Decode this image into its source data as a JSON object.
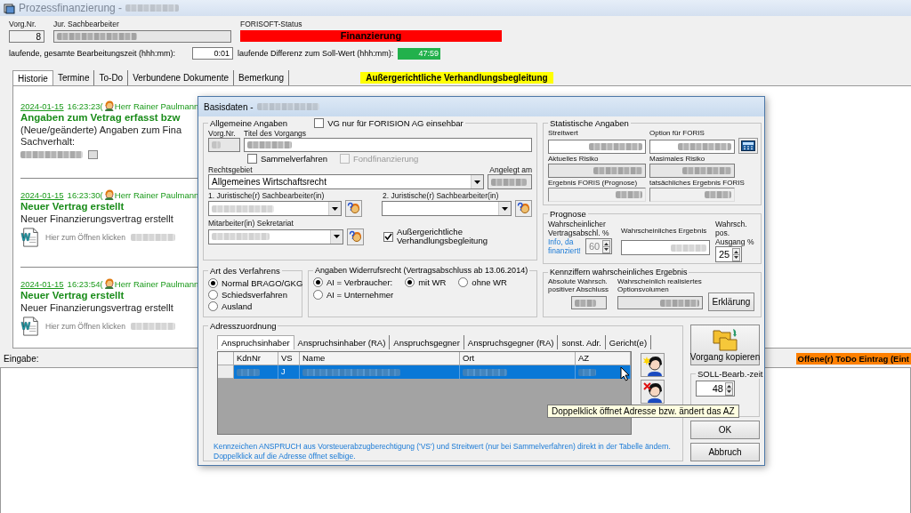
{
  "window": {
    "title": "Prozessfinanzierung -"
  },
  "header": {
    "vorg_nr_label": "Vorg.Nr.",
    "vorg_nr": "8",
    "sachbearbeiter_label": "Jur. Sachbearbeiter",
    "status_label": "FORISOFT-Status",
    "status": "Finanzierung",
    "time_label": "laufende, gesamte Bearbeitungszeit (hhh:mm):",
    "time": "0:01",
    "diff_label": "laufende Differenz zum Soll-Wert (hhh:mm):",
    "diff": "47:59"
  },
  "tabs": [
    {
      "label": "Historie",
      "selected": true
    },
    {
      "label": "Termine",
      "selected": false
    },
    {
      "label": "To-Do",
      "selected": false
    },
    {
      "label": "Verbundene Dokumente",
      "selected": false
    },
    {
      "label": "Bemerkung",
      "selected": false
    }
  ],
  "flag": "Außergerichtliche Verhandlungsbegleitung",
  "history": [
    {
      "date": "2024-01-15",
      "time": "16:23:23(",
      "user": "Herr Rainer Paulmann",
      "title": "Angaben zum Vetrag erfasst bzw",
      "lines": [
        "(Neue/geänderte) Angaben zum Fina",
        "Sachverhalt:"
      ],
      "attachment": {
        "kind": "note"
      }
    },
    {
      "date": "2024-01-15",
      "time": "16:23:30(",
      "user": "Herr Rainer Paulmann",
      "title": "Neuer Vertrag erstellt",
      "lines": [
        "Neuer Finanzierungsvertrag erstellt"
      ],
      "attachment": {
        "kind": "document",
        "label": "Hier zum Öffnen klicken"
      }
    },
    {
      "date": "2024-01-15",
      "time": "16:23:54(",
      "user": "Herr Rainer Paulmann",
      "title": "Neuer Vertrag erstellt",
      "lines": [
        "Neuer Finanzierungsvertrag erstellt"
      ],
      "attachment": {
        "kind": "document",
        "label": "Hier zum Öffnen klicken"
      }
    }
  ],
  "input_label": "Eingabe:",
  "todo_badge": "Offene(r) ToDo Eintrag (Eint",
  "dialog": {
    "title": "Basisdaten -",
    "general": {
      "legend": "Allgemeine Angaben",
      "visibility": {
        "label": "VG nur für FORISION AG einsehbar",
        "checked": false
      },
      "vorg_nr_label": "Vorg.Nr.",
      "title_label": "Titel des Vorgangs",
      "checkboxes": [
        {
          "label": "Sammelverfahren",
          "checked": false,
          "disabled": false
        },
        {
          "label": "Fondfinanzierung",
          "checked": false,
          "disabled": true
        }
      ],
      "rechtsgebiet_label": "Rechtsgebiet",
      "rechtsgebiet": "Allgemeines Wirtschaftsrecht",
      "angelegt_label": "Angelegt am",
      "sb1_label": "1. Juristische(r) Sachbearbeiter(in)",
      "sb2_label": "2. Juristische(r) Sachbearbeiter(in)",
      "sekretariat_label": "Mitarbeiter(in) Sekretariat",
      "flag": {
        "label": "Außergerichtliche Verhandlungsbegleitung",
        "checked": true
      }
    },
    "verfahren": {
      "legend": "Art des Verfahrens",
      "options": [
        {
          "label": "Normal BRAGO/GKG",
          "selected": true
        },
        {
          "label": "Schiedsverfahren",
          "selected": false
        },
        {
          "label": "Ausland",
          "selected": false
        }
      ]
    },
    "widerruf": {
      "legend": "Angaben Widerrufsrecht (Vertragsabschluss ab 13.06.2014)",
      "ai_options": [
        {
          "label": "AI = Verbraucher:",
          "selected": true
        },
        {
          "label": "AI = Unternehmer",
          "selected": false
        }
      ],
      "wr_options": [
        {
          "label": "mit WR",
          "selected": true
        },
        {
          "label": "ohne WR",
          "selected": false
        }
      ]
    },
    "statistik": {
      "legend": "Statistische Angaben",
      "fields": [
        {
          "label": "Streitwert",
          "kind": "input"
        },
        {
          "label": "Option für FORIS",
          "kind": "input"
        },
        {
          "label": "Aktuelles Risiko",
          "kind": "readonly"
        },
        {
          "label": "Masimales Risiko",
          "kind": "readonly"
        },
        {
          "label": "Ergebnis FORIS (Prognose)",
          "kind": "output"
        },
        {
          "label": "tatsächliches Ergebnis FORIS",
          "kind": "output"
        }
      ]
    },
    "prognose": {
      "legend": "Prognose",
      "abschluss_label": "Wahrscheinlicher Vertragsabschl. %",
      "info": "Info, da finanziert!",
      "abschluss": {
        "value": "60",
        "disabled": true
      },
      "ergebnis_label": "Wahrscheinliches Ergebnis",
      "ausgang_label": "Wahrsch. pos. Ausgang %",
      "ausgang": {
        "value": "25",
        "disabled": false
      }
    },
    "kennziffern": {
      "legend": "Kennziffern wahrscheinliches Ergebnis",
      "abs_label": "Absolute Wahrsch. positiver Abschluss",
      "vol_label": "Wahrscheinlich realisiertes Optionsvolumen",
      "button": "Erklärung"
    },
    "adressen": {
      "legend": "Adresszuordnung",
      "tabs": [
        {
          "label": "Anspruchsinhaber",
          "selected": true
        },
        {
          "label": "Anspruchsinhaber (RA)",
          "selected": false
        },
        {
          "label": "Anspruchsgegner",
          "selected": false
        },
        {
          "label": "Anspruchsgegner (RA)",
          "selected": false
        },
        {
          "label": "sonst. Adr.",
          "selected": false
        },
        {
          "label": "Gericht(e)",
          "selected": false
        }
      ],
      "columns": [
        "KdnNr",
        "VS",
        "Name",
        "Ort",
        "AZ"
      ],
      "rows": [
        {
          "vs": "J",
          "selected": true
        }
      ],
      "note": "Kennzeichen ANSPRUCH aus Vorsteuerabzugberechtigung ('VS') und Streitwert (nur bei Sammelverfahren) direkt in der Tabelle ändern. Doppelklick auf die Adresse öffnet selbige."
    },
    "copy_button": "Vorgang kopieren",
    "soll": {
      "legend": "SOLL-Bearb.-zeit",
      "value": "48"
    },
    "ok": "OK",
    "cancel": "Abbruch",
    "tooltip": "Doppelklick öffnet Adresse bzw. ändert das AZ"
  }
}
